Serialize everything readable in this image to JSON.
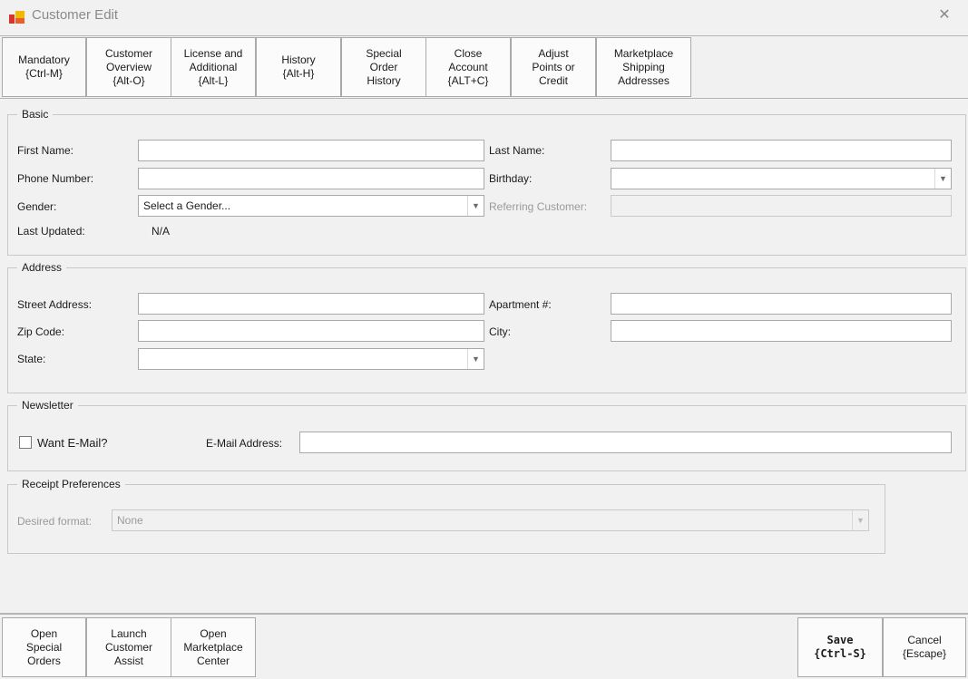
{
  "window": {
    "title": "Customer Edit",
    "close_icon": "close-icon"
  },
  "tabs": [
    {
      "label": "Mandatory\n{Ctrl-M}"
    },
    {
      "label": "Customer\nOverview\n{Alt-O}"
    },
    {
      "label": "License and\nAdditional\n{Alt-L}"
    },
    {
      "label": "History\n{Alt-H}"
    },
    {
      "label": "Special\nOrder\nHistory"
    },
    {
      "label": "Close\nAccount\n{ALT+C}"
    },
    {
      "label": "Adjust\nPoints or\nCredit"
    },
    {
      "label": "Marketplace\nShipping\nAddresses"
    }
  ],
  "basic": {
    "legend": "Basic",
    "first_name_label": "First Name:",
    "first_name_value": "",
    "last_name_label": "Last Name:",
    "last_name_value": "",
    "phone_label": "Phone Number:",
    "phone_value": "",
    "birthday_label": "Birthday:",
    "birthday_value": "",
    "gender_label": "Gender:",
    "gender_value": "Select a Gender...",
    "referring_label": "Referring Customer:",
    "referring_value": "",
    "last_updated_label": "Last Updated:",
    "last_updated_value": "N/A"
  },
  "address": {
    "legend": "Address",
    "street_label": "Street Address:",
    "street_value": "",
    "apartment_label": "Apartment #:",
    "apartment_value": "",
    "zip_label": "Zip Code:",
    "zip_value": "",
    "city_label": "City:",
    "city_value": "",
    "state_label": "State:",
    "state_value": ""
  },
  "newsletter": {
    "legend": "Newsletter",
    "want_email_label": "Want E-Mail?",
    "want_email_checked": false,
    "email_label": "E-Mail Address:",
    "email_value": ""
  },
  "receipt": {
    "legend": "Receipt Preferences",
    "format_label": "Desired format:",
    "format_value": "None"
  },
  "footer": {
    "open_special_orders": "Open\nSpecial\nOrders",
    "launch_customer_assist": "Launch\nCustomer\nAssist",
    "open_marketplace_center": "Open\nMarketplace\nCenter",
    "save": "Save\n{Ctrl-S}",
    "cancel": "Cancel\n{Escape}"
  },
  "colors": {
    "icon_orange": "#e8602c",
    "icon_yellow": "#f5b800",
    "icon_red": "#d9342b",
    "window_bg": "#f1f1f1",
    "border": "#a9a9a9"
  }
}
